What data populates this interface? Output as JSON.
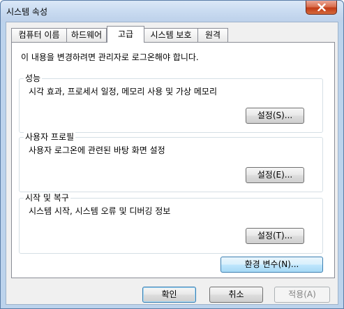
{
  "window": {
    "title": "시스템 속성"
  },
  "tabs": [
    {
      "label": "컴퓨터 이름",
      "active": false
    },
    {
      "label": "하드웨어",
      "active": false
    },
    {
      "label": "고급",
      "active": true
    },
    {
      "label": "시스템 보호",
      "active": false
    },
    {
      "label": "원격",
      "active": false
    }
  ],
  "advanced": {
    "notice": "이 내용을 변경하려면 관리자로 로그온해야 합니다.",
    "performance": {
      "title": "성능",
      "description": "시각 효과, 프로세서 일정, 메모리 사용 및 가상 메모리",
      "button": "설정(S)..."
    },
    "user_profiles": {
      "title": "사용자 프로필",
      "description": "사용자 로그온에 관련된 바탕 화면 설정",
      "button": "설정(E)..."
    },
    "startup_recovery": {
      "title": "시작 및 복구",
      "description": "시스템 시작, 시스템 오류 및 디버깅 정보",
      "button": "설정(T)..."
    },
    "env_button": "환경 변수(N)..."
  },
  "footer": {
    "ok": "확인",
    "cancel": "취소",
    "apply": "적용(A)"
  },
  "colors": {
    "accent": "#3c7fb1",
    "close": "#c23b17"
  }
}
